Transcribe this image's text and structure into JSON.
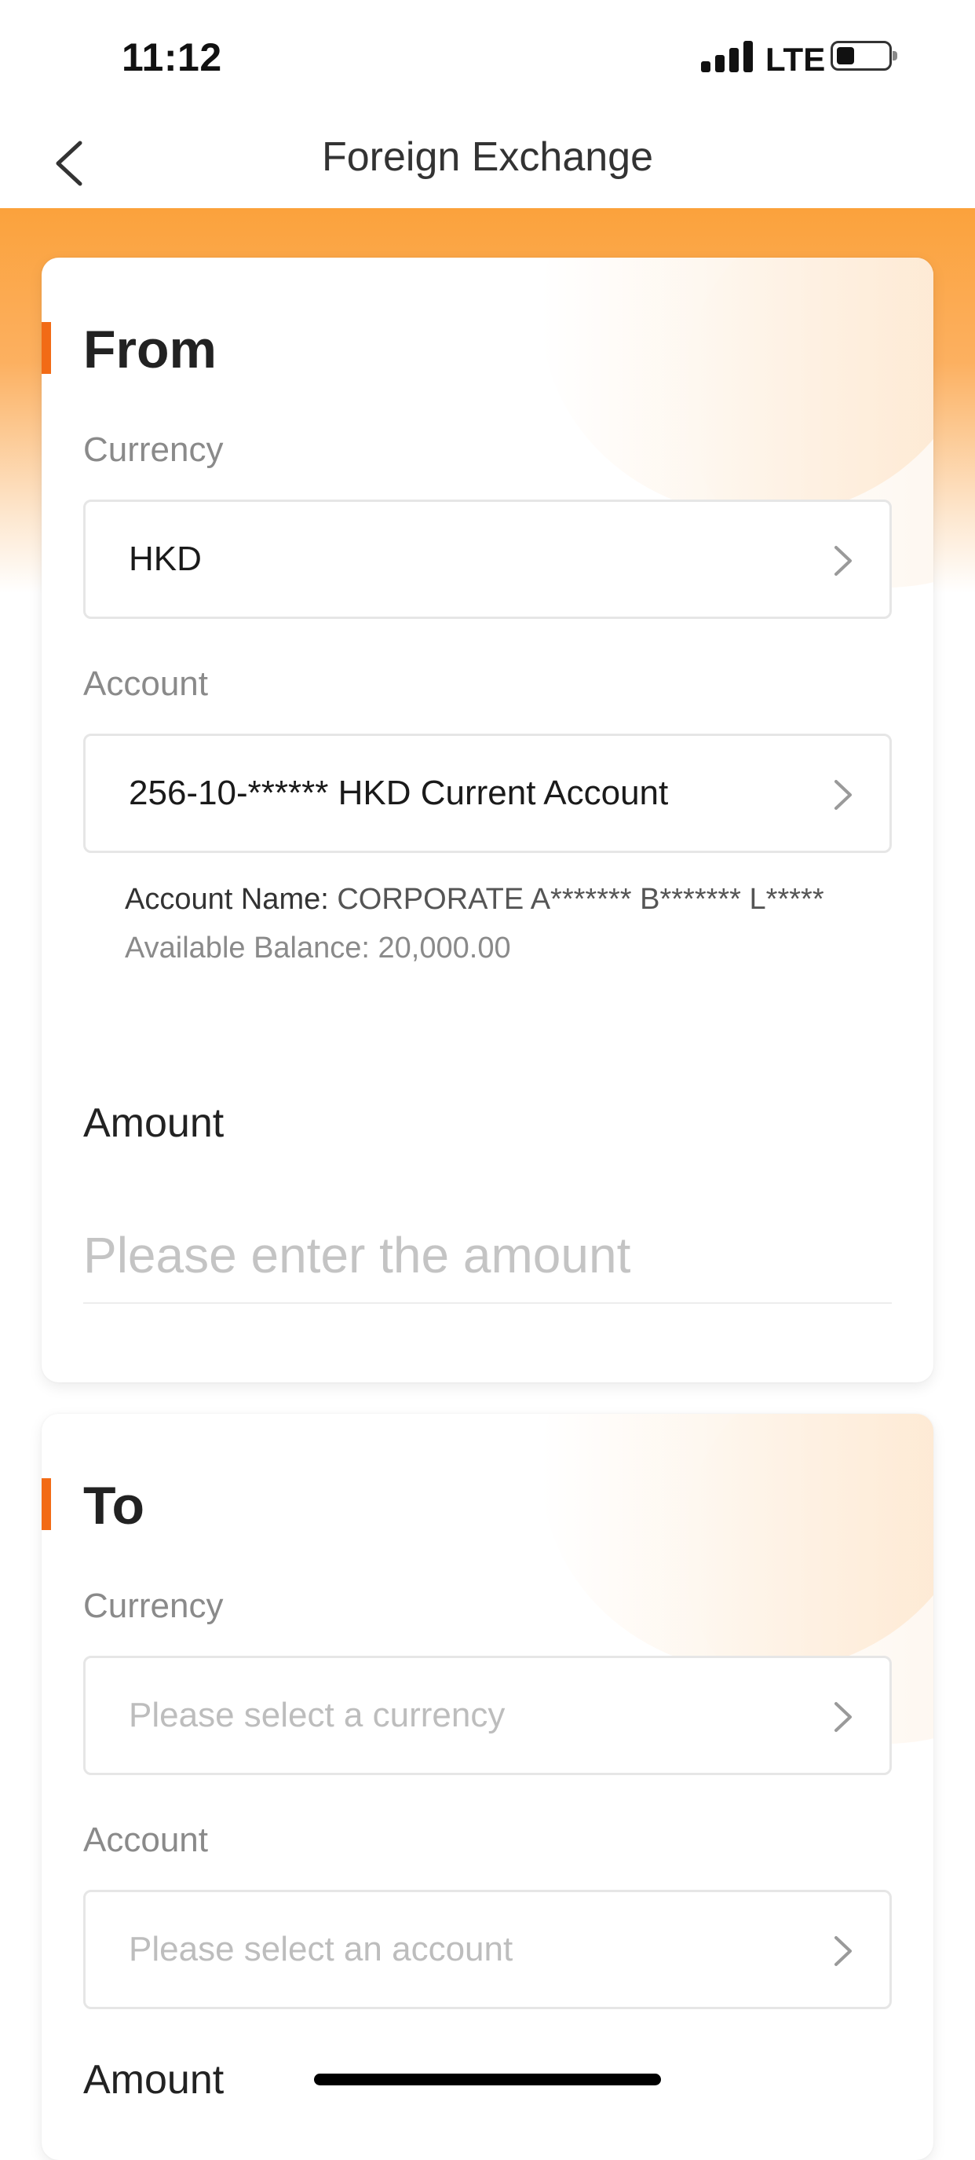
{
  "status_bar": {
    "time": "11:12",
    "network": "LTE"
  },
  "nav": {
    "title": "Foreign Exchange",
    "back_icon": "chevron-left-icon"
  },
  "colors": {
    "accent": "#f26b16",
    "header_orange": "#fba23c",
    "placeholder": "#bdbdbd"
  },
  "from": {
    "title": "From",
    "currency_label": "Currency",
    "currency_value": "HKD",
    "account_label": "Account",
    "account_value": "256-10-****** HKD Current Account",
    "account_name_label": "Account Name:",
    "account_name_value": "CORPORATE A******* B******* L*****",
    "balance_label": "Available Balance:",
    "balance_value": "20,000.00",
    "amount_label": "Amount",
    "amount_placeholder": "Please enter the amount"
  },
  "to": {
    "title": "To",
    "currency_label": "Currency",
    "currency_placeholder": "Please select a currency",
    "account_label": "Account",
    "account_placeholder": "Please select an account",
    "amount_label": "Amount"
  }
}
